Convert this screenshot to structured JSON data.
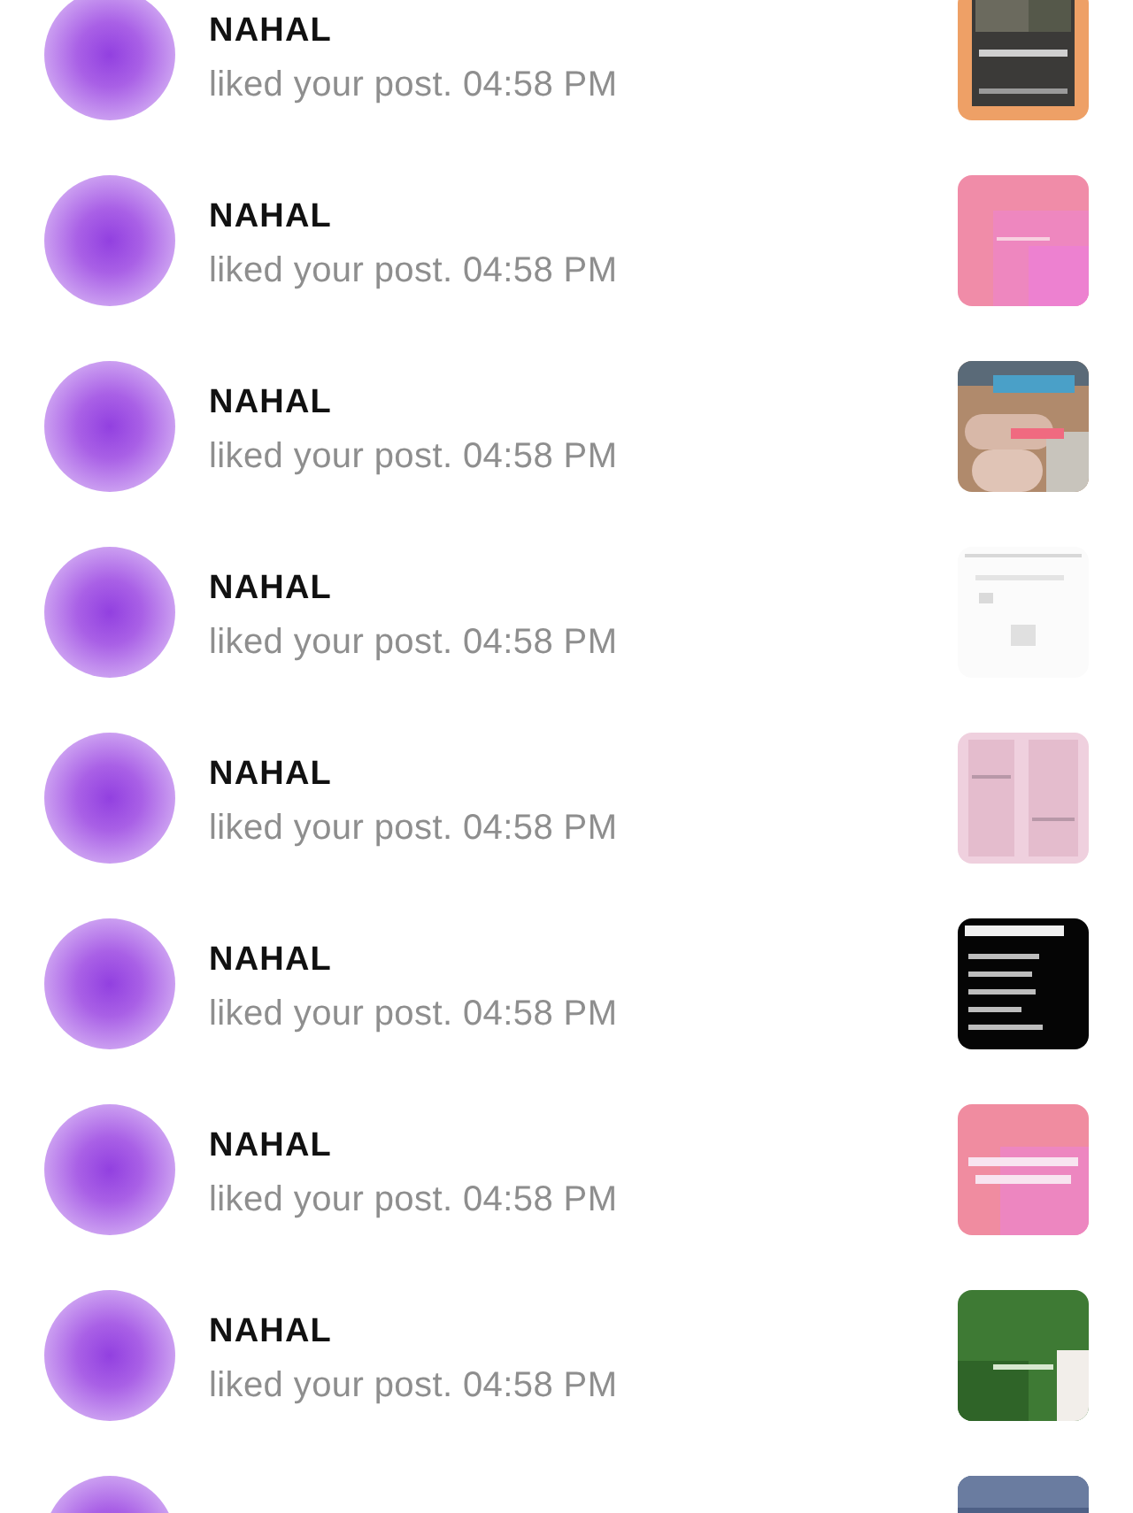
{
  "notifications": [
    {
      "name": "NAHAL",
      "text": "liked your post. 04:58 PM"
    },
    {
      "name": "NAHAL",
      "text": "liked your post. 04:58 PM"
    },
    {
      "name": "NAHAL",
      "text": "liked your post. 04:58 PM"
    },
    {
      "name": "NAHAL",
      "text": "liked your post. 04:58 PM"
    },
    {
      "name": "NAHAL",
      "text": "liked your post. 04:58 PM"
    },
    {
      "name": "NAHAL",
      "text": "liked your post. 04:58 PM"
    },
    {
      "name": "NAHAL",
      "text": "liked your post. 04:58 PM"
    },
    {
      "name": "NAHAL",
      "text": "liked your post. 04:58 PM"
    }
  ]
}
